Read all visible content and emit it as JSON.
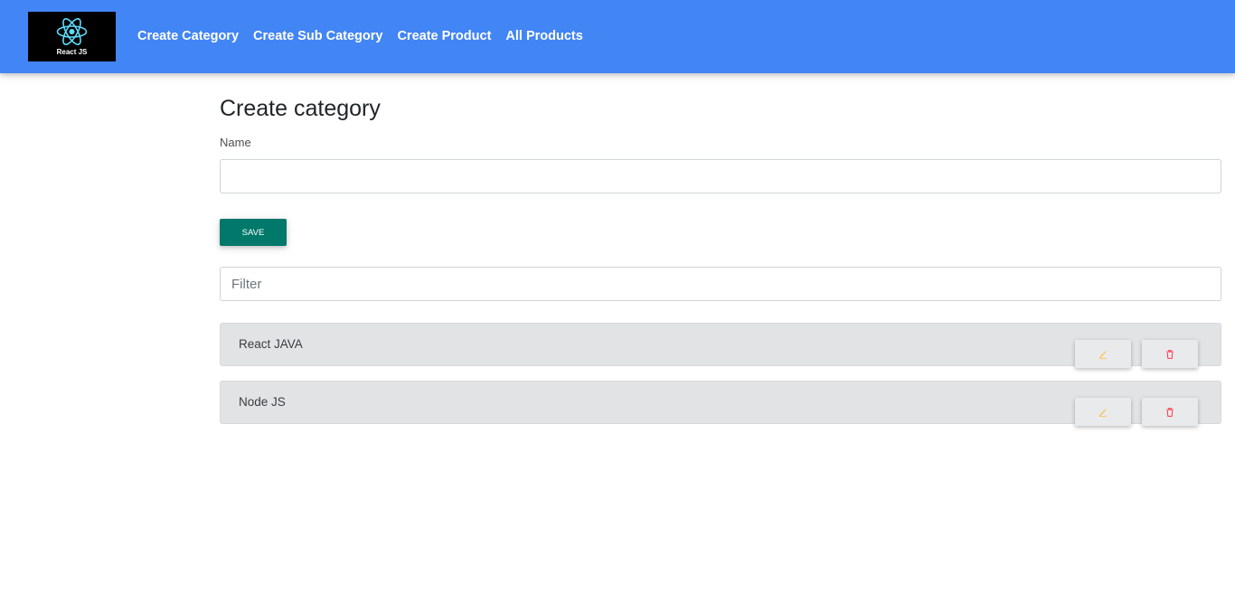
{
  "navbar": {
    "logo_text": "React JS",
    "links": [
      "Create Category",
      "Create Sub Category",
      "Create Product",
      "All Products"
    ],
    "background_color": "#4285f4"
  },
  "form": {
    "title": "Create category",
    "name_label": "Name",
    "name_value": "",
    "save_label": "SAVE",
    "save_color": "#00796b"
  },
  "filter": {
    "placeholder": "Filter",
    "value": ""
  },
  "categories": [
    {
      "name": "React JAVA",
      "edit_icon": "pencil-icon",
      "delete_icon": "trash-icon"
    },
    {
      "name": "Node JS",
      "edit_icon": "pencil-icon",
      "delete_icon": "trash-icon"
    }
  ],
  "colors": {
    "edit_icon": "#ffbb33",
    "delete_icon": "#ff3547"
  }
}
